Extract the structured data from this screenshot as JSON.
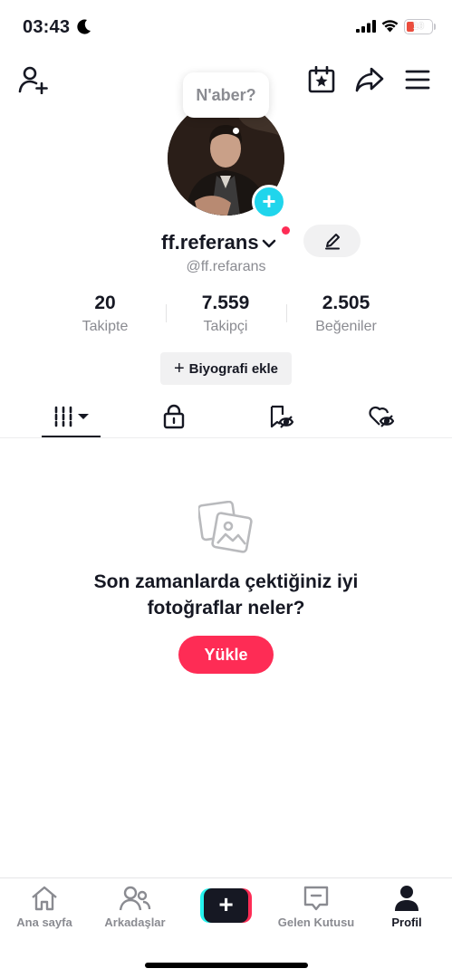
{
  "status_bar": {
    "time": "03:43",
    "battery": "10",
    "battery_color": "#eb4d3d"
  },
  "header": {
    "icons": [
      "add-user-icon",
      "calendar-star-icon",
      "share-icon",
      "menu-icon"
    ]
  },
  "profile": {
    "bubble_text": "N'aber?",
    "username": "ff.referans",
    "handle": "@ff.refarans",
    "stats": [
      {
        "value": "20",
        "label": "Takipte"
      },
      {
        "value": "7.559",
        "label": "Takipçi"
      },
      {
        "value": "2.505",
        "label": "Beğeniler"
      }
    ],
    "bio_button": "Biyografi ekle",
    "bio_plus": "+"
  },
  "tabs": [
    {
      "name": "videos",
      "icon": "grid-icon",
      "active": true
    },
    {
      "name": "private",
      "icon": "lock-icon"
    },
    {
      "name": "reposts",
      "icon": "repost-eye-icon"
    },
    {
      "name": "liked",
      "icon": "heart-eye-icon"
    }
  ],
  "empty_state": {
    "title": "Son zamanlarda çektiğiniz iyi fotoğraflar neler?",
    "button": "Yükle"
  },
  "bottom_nav": {
    "home": "Ana sayfa",
    "friends": "Arkadaşlar",
    "create": "+",
    "inbox": "Gelen Kutusu",
    "profile": "Profil"
  },
  "colors": {
    "accent": "#fe2c55",
    "cyan": "#25f4ee",
    "add_badge": "#20d5ec",
    "text": "#161823",
    "muted": "#8a8b91"
  }
}
